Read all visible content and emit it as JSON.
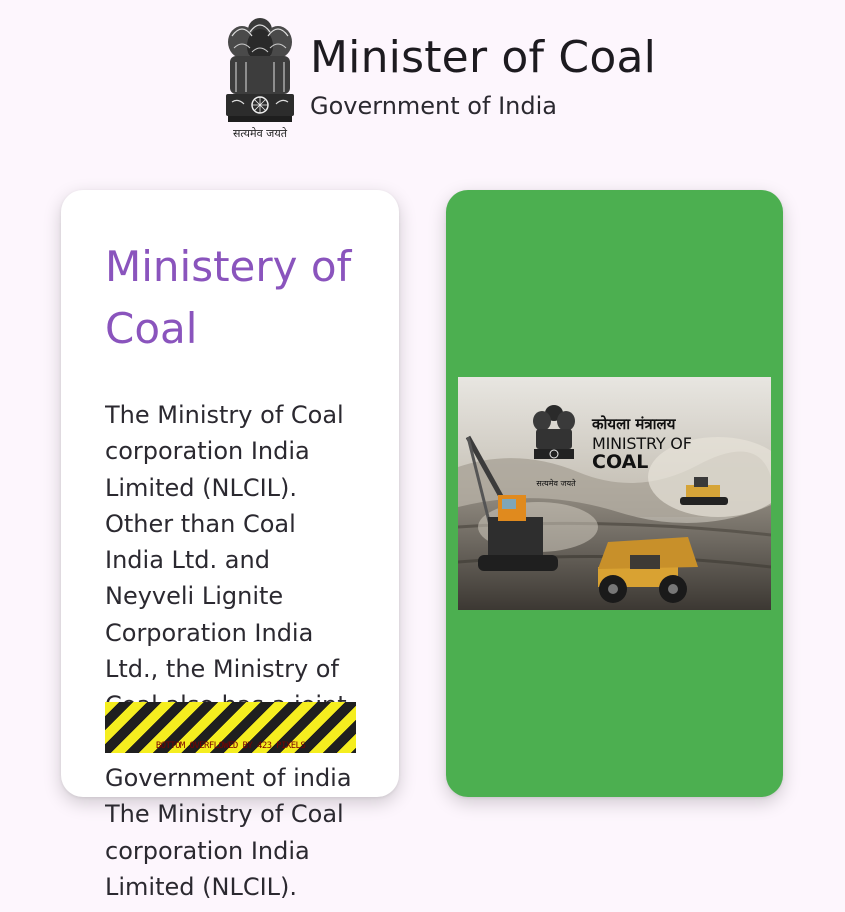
{
  "header": {
    "emblem_icon": "ashoka-emblem-icon",
    "emblem_motto": "सत्यमेव जयते",
    "title": "Minister of Coal",
    "subtitle": "Government of India"
  },
  "info_card": {
    "title": "Ministery of Coal",
    "body": "The Ministry of Coal corporation India Limited (NLCIL). Other than Coal India Ltd. and Neyveli Lignite Corporation India Ltd., the Ministry of Coal also has a joint venture with Government of india The Ministry of Coal corporation India Limited (NLCIL). Other than Coal India Ltd. and Neyveli",
    "overflow_warning": "BOTTOM OVERFLOWED BY 423 PIXELS",
    "warning_colors": {
      "stripe_yellow": "#f5ee1f",
      "stripe_black": "#1f1f1f",
      "text": "#7a0000"
    },
    "title_color": "#8a54bd",
    "background": "#ffffff"
  },
  "image_card": {
    "background": "#4caf50",
    "banner": {
      "icon": "mining-site-photo-icon",
      "emblem_icon": "ashoka-emblem-icon",
      "hindi_text": "कोयला मंत्रालय",
      "line1": "MINISTRY OF",
      "line2": "COAL",
      "motto": "सत्यमेव जयते"
    }
  }
}
